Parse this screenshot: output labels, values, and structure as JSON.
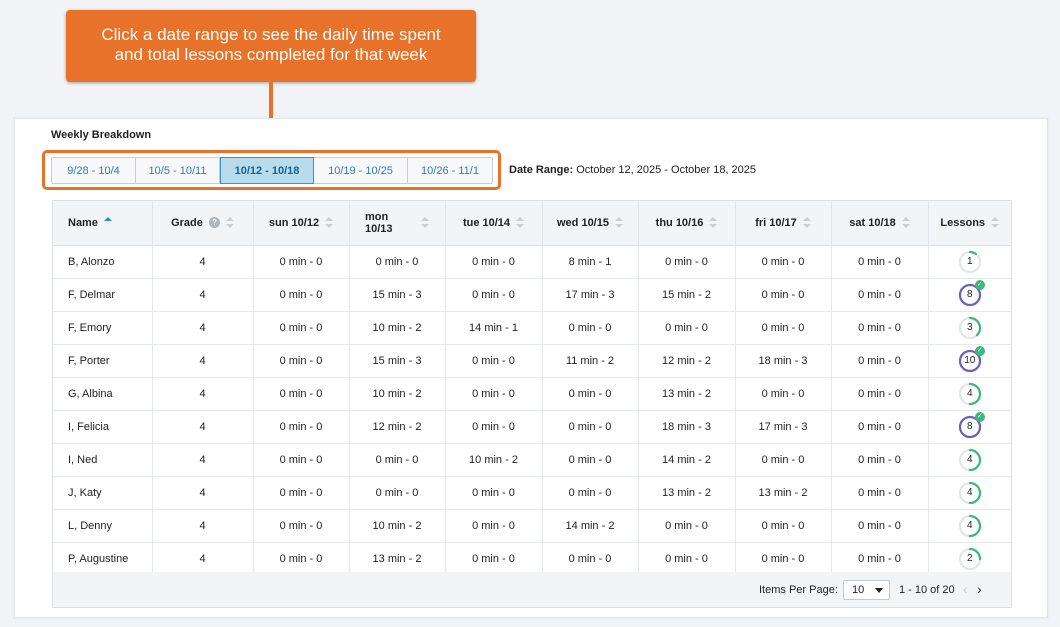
{
  "callout": {
    "line1": "Click a date range to see the daily time spent",
    "line2": "and total lessons completed for that week"
  },
  "section_title": "Weekly Breakdown",
  "date_ranges": [
    "9/28 - 10/4",
    "10/5 - 10/11",
    "10/12 - 10/18",
    "10/19 - 10/25",
    "10/26 - 11/1"
  ],
  "active_range_index": 2,
  "date_range": {
    "label": "Date Range:",
    "value": " October 12, 2025 - October 18, 2025"
  },
  "table": {
    "headers": {
      "name": "Name",
      "grade": "Grade",
      "sun": "sun 10/12",
      "mon": "mon 10/13",
      "tue": "tue 10/14",
      "wed": "wed 10/15",
      "thu": "thu 10/16",
      "fri": "fri 10/17",
      "sat": "sat 10/18",
      "lessons": "Lessons"
    },
    "rows": [
      {
        "name": "B, Alonzo",
        "grade": "4",
        "sun": "0 min - 0",
        "mon": "0 min - 0",
        "tue": "0 min - 0",
        "wed": "8 min - 1",
        "thu": "0 min - 0",
        "fri": "0 min - 0",
        "sat": "0 min - 0",
        "lessons": "1",
        "progress": 0.1,
        "complete": false
      },
      {
        "name": "F, Delmar",
        "grade": "4",
        "sun": "0 min - 0",
        "mon": "15 min - 3",
        "tue": "0 min - 0",
        "wed": "17 min - 3",
        "thu": "15 min - 2",
        "fri": "0 min - 0",
        "sat": "0 min - 0",
        "lessons": "8",
        "progress": 1.0,
        "complete": true
      },
      {
        "name": "F, Emory",
        "grade": "4",
        "sun": "0 min - 0",
        "mon": "10 min - 2",
        "tue": "14 min - 1",
        "wed": "0 min - 0",
        "thu": "0 min - 0",
        "fri": "0 min - 0",
        "sat": "0 min - 0",
        "lessons": "3",
        "progress": 0.375,
        "complete": false
      },
      {
        "name": "F, Porter",
        "grade": "4",
        "sun": "0 min - 0",
        "mon": "15 min - 3",
        "tue": "0 min - 0",
        "wed": "11 min - 2",
        "thu": "12 min - 2",
        "fri": "18 min - 3",
        "sat": "0 min - 0",
        "lessons": "10",
        "progress": 1.0,
        "complete": true
      },
      {
        "name": "G, Albina",
        "grade": "4",
        "sun": "0 min - 0",
        "mon": "10 min - 2",
        "tue": "0 min - 0",
        "wed": "0 min - 0",
        "thu": "13 min - 2",
        "fri": "0 min - 0",
        "sat": "0 min - 0",
        "lessons": "4",
        "progress": 0.5,
        "complete": false
      },
      {
        "name": "I, Felicia",
        "grade": "4",
        "sun": "0 min - 0",
        "mon": "12 min - 2",
        "tue": "0 min - 0",
        "wed": "0 min - 0",
        "thu": "18 min - 3",
        "fri": "17 min - 3",
        "sat": "0 min - 0",
        "lessons": "8",
        "progress": 1.0,
        "complete": true
      },
      {
        "name": "I, Ned",
        "grade": "4",
        "sun": "0 min - 0",
        "mon": "0 min - 0",
        "tue": "10 min - 2",
        "wed": "0 min - 0",
        "thu": "14 min - 2",
        "fri": "0 min - 0",
        "sat": "0 min - 0",
        "lessons": "4",
        "progress": 0.5,
        "complete": false
      },
      {
        "name": "J, Katy",
        "grade": "4",
        "sun": "0 min - 0",
        "mon": "0 min - 0",
        "tue": "0 min - 0",
        "wed": "0 min - 0",
        "thu": "13 min - 2",
        "fri": "13 min - 2",
        "sat": "0 min - 0",
        "lessons": "4",
        "progress": 0.5,
        "complete": false
      },
      {
        "name": "L, Denny",
        "grade": "4",
        "sun": "0 min - 0",
        "mon": "10 min - 2",
        "tue": "0 min - 0",
        "wed": "14 min - 2",
        "thu": "0 min - 0",
        "fri": "0 min - 0",
        "sat": "0 min - 0",
        "lessons": "4",
        "progress": 0.5,
        "complete": false
      },
      {
        "name": "P, Augustine",
        "grade": "4",
        "sun": "0 min - 0",
        "mon": "13 min - 2",
        "tue": "0 min - 0",
        "wed": "0 min - 0",
        "thu": "0 min - 0",
        "fri": "0 min - 0",
        "sat": "0 min - 0",
        "lessons": "2",
        "progress": 0.25,
        "complete": false
      }
    ]
  },
  "footer": {
    "items_per_page_label": "Items Per Page:",
    "items_per_page_value": "10",
    "range_text": "1 - 10 of 20",
    "prev_icon": "chevron-left-icon",
    "next_icon": "chevron-right-icon"
  },
  "colors": {
    "accent_orange": "#e8722a",
    "link_blue": "#2a7fb8",
    "active_range_bg": "#b6dced",
    "ring_teal": "#3cb878",
    "ring_complete": "#6a5fc1",
    "ring_track": "#e2e5e9"
  }
}
